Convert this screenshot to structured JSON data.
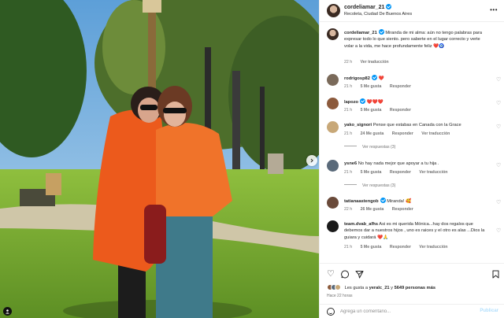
{
  "post": {
    "username": "cordeliamar_21",
    "location": "Recoleta, Ciudad De Buenos Aires"
  },
  "caption": {
    "username": "cordeliamar_21",
    "text": "Miranda de mi alma: aún no tengo palabras para expresar todo lo que siento. pero saberte en el lugar correcto y verte volar a la vida, me hace profundamente feliz",
    "emoji": "❤️🧿",
    "time": "22 h",
    "translate": "Ver traducción"
  },
  "comments": [
    {
      "username": "rodrigosp82",
      "text": "",
      "emoji": "❤️",
      "time": "21 h",
      "likes": "5 Me gusta",
      "reply": "Responder",
      "translate": ""
    },
    {
      "username": "lapozo",
      "text": "",
      "emoji": "❤️❤️❤️",
      "time": "21 h",
      "likes": "5 Me gusta",
      "reply": "Responder",
      "translate": ""
    },
    {
      "username": "yako_signori",
      "text": "Pense que estabas en Canada con la Grace",
      "emoji": "",
      "time": "21 h",
      "likes": "24 Me gusta",
      "reply": "Responder",
      "translate": "Ver traducción",
      "view_replies": "Ver respuestas (3)"
    },
    {
      "username": "ysne6",
      "text": "No hay nada mejor que apoyar a tu hija .",
      "emoji": "",
      "time": "21 h",
      "likes": "5 Me gusta",
      "reply": "Responder",
      "translate": "Ver traducción",
      "view_replies": "Ver respuestas (3)"
    },
    {
      "username": "tatianaastengob",
      "text": "Miranda!",
      "emoji": "🥰",
      "time": "22 h",
      "likes": "26 Me gusta",
      "reply": "Responder",
      "translate": ""
    },
    {
      "username": "team.dvab_afhs",
      "text": "Asi es mi querida Mónica...hay dos regalos que debemos dar a nuestros hijos , uno es raices y el otro es alas ...Dios la guiara y cuidará",
      "emoji": "❤️🙏",
      "time": "21 h",
      "likes": "5 Me gusta",
      "reply": "Responder",
      "translate": "Ver traducción"
    }
  ],
  "footer": {
    "likes_prefix": "Les gusta a",
    "likes_user": "yeralc_21",
    "likes_mid": "y",
    "likes_count": "5649 personas más",
    "time_ago": "Hace 22 horas",
    "comment_placeholder": "Agrega un comentario...",
    "publish_label": "Publicar"
  },
  "colors": {
    "verified": "#0095f6",
    "heart": "#ed4956",
    "publish": "#b2dffc"
  }
}
